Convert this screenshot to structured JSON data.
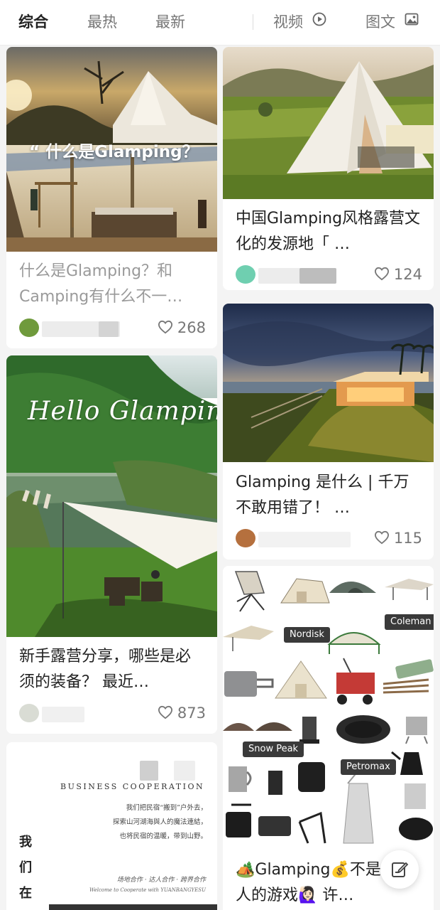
{
  "tabs": {
    "comprehensive": "综合",
    "hottest": "最热",
    "newest": "最新",
    "video": "视频",
    "image_text": "图文"
  },
  "feed": {
    "card1": {
      "photo_overlay": "“ 什么是Glamping？",
      "title": "什么是Glamping？和Camping有什么不一…",
      "likes": "268"
    },
    "card2": {
      "title": "中国Glamping风格露营文化的发源地「 …",
      "likes": "124"
    },
    "card3": {
      "photo_overlay": "Hello Glamping",
      "title": "新手露营分享，哪些是必须的装备？ 最近…",
      "likes": "873"
    },
    "card4": {
      "title": "Glamping 是什么 | 千万不敢用错了！ …",
      "likes": "115"
    },
    "card5": {
      "brands": [
        "Coleman",
        "Nordisk",
        "Snow Peak",
        "Petromax"
      ],
      "title": "🏕️Glamping💰不是有钱人的游戏🙋🏻‍♀️ 许…"
    },
    "card6": {
      "heading": "BUSINESS COOPERATION",
      "body_lines": [
        "我们把民宿“搬到”户外去，",
        "探索山河湖海與人的魔法連結，",
        "也将民宿的温暖，带到山野。"
      ],
      "partners": "场地合作 · 达人合作 · 跨界合作",
      "welcome": "Welcome to Cooperate with YUANBANGYESU",
      "vertical": [
        "我",
        "们",
        "在"
      ]
    }
  },
  "colors": {
    "accent_avatar_green": "#6f9a3c",
    "accent_avatar_teal": "#6fcfb0",
    "accent_avatar_brown": "#b5703e"
  }
}
